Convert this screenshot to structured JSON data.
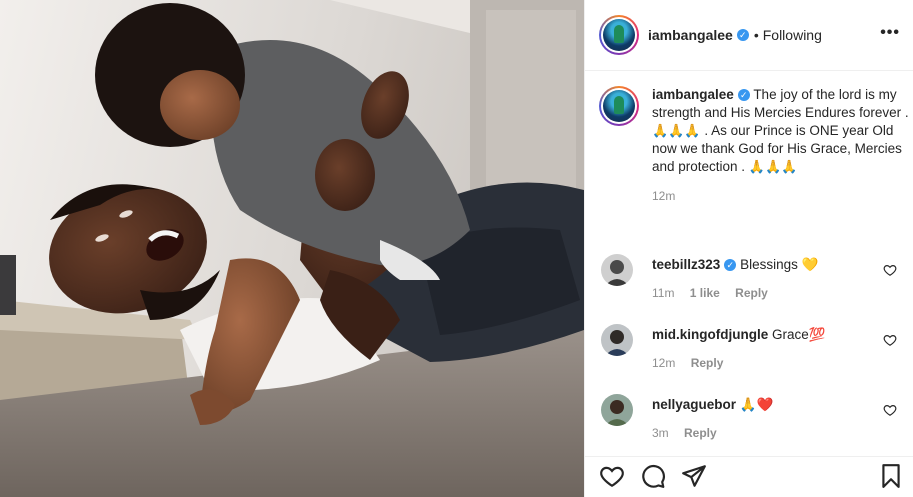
{
  "post": {
    "username": "iambangalee",
    "follow_state": "Following",
    "more_label": "•••",
    "separator": "•"
  },
  "caption": {
    "username": "iambangalee",
    "text_1": "The joy of the lord is my strength and His Mercies Endures forever . ",
    "emoji_1": "🙏🙏🙏",
    "text_2": ". As our Prince is ONE year Old now we thank God for His Grace, Mercies and protection . ",
    "emoji_2": "🙏🙏🙏",
    "time": "12m"
  },
  "comments": [
    {
      "username": "teebillz323",
      "verified": true,
      "text": "Blessings",
      "emoji": "💛",
      "time": "11m",
      "likes": "1 like",
      "reply": "Reply"
    },
    {
      "username": "mid.kingofdjungle",
      "verified": false,
      "text": "Grace",
      "emoji": "💯",
      "time": "12m",
      "reply": "Reply"
    },
    {
      "username": "nellyaguebor",
      "verified": false,
      "text": "",
      "emoji": "🙏❤️",
      "time": "3m",
      "reply": "Reply"
    }
  ],
  "icons": {
    "verified": "✓",
    "like": "heart-icon",
    "comment": "comment-icon",
    "share": "share-icon",
    "save": "bookmark-icon"
  },
  "colors": {
    "verified_blue": "#3897f0",
    "meta_gray": "#8e8e8e",
    "text": "#262626"
  }
}
